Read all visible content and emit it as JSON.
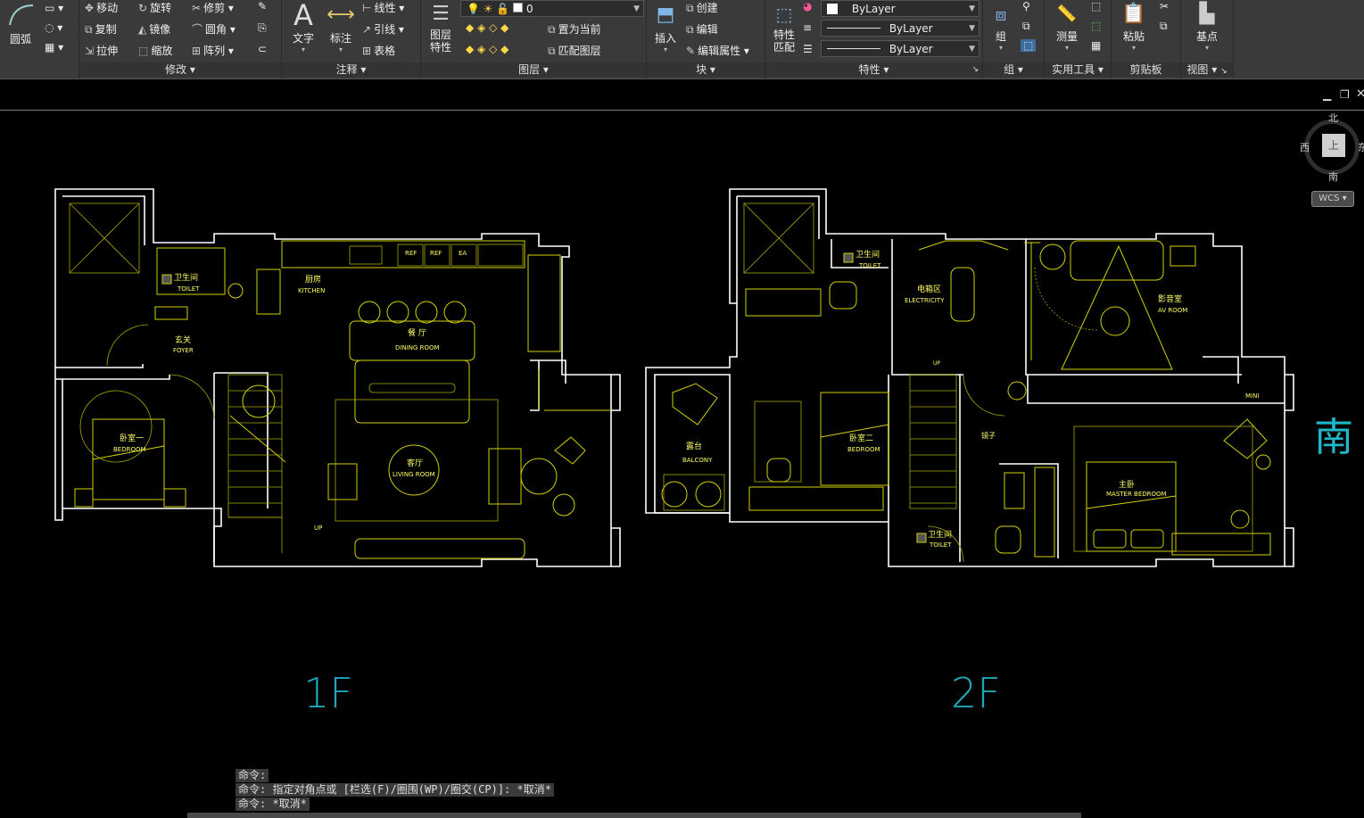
{
  "ribbon": {
    "draw": {
      "arc_label": "圆弧"
    },
    "modify": {
      "title": "修改",
      "move": "移动",
      "rotate": "旋转",
      "trim": "修剪",
      "copy": "复制",
      "mirror": "镜像",
      "fillet": "圆角",
      "stretch": "拉伸",
      "scale": "缩放",
      "array": "阵列"
    },
    "annotation": {
      "title": "注释",
      "text": "文字",
      "dimension": "标注",
      "linear": "线性",
      "leader": "引线",
      "table": "表格"
    },
    "layers": {
      "title": "图层",
      "properties_line1": "图层",
      "properties_line2": "特性",
      "current_layer": "0",
      "set_current": "置为当前",
      "match_layer": "匹配图层"
    },
    "block": {
      "title": "块",
      "insert": "插入",
      "create": "创建",
      "edit": "编辑",
      "edit_attr": "编辑属性"
    },
    "properties": {
      "title": "特性",
      "match_line1": "特性",
      "match_line2": "匹配",
      "color": "ByLayer",
      "linetype": "ByLayer",
      "lineweight": "ByLayer"
    },
    "group": {
      "title": "组",
      "group": "组"
    },
    "utilities": {
      "title": "实用工具",
      "measure": "测量"
    },
    "clipboard": {
      "title": "剪贴板",
      "paste": "粘贴"
    },
    "view": {
      "title": "视图",
      "basepoint": "基点"
    }
  },
  "viewcube": {
    "north": "北",
    "south": "南",
    "west": "西",
    "east": "东",
    "top": "上",
    "wcs": "WCS"
  },
  "side_label": "南",
  "plan": {
    "f1": {
      "label": "1F",
      "rooms": {
        "toilet_cn": "卫生间",
        "toilet_en": "TOILET",
        "kitchen_cn": "厨房",
        "kitchen_en": "KITCHEN",
        "foyer_cn": "玄关",
        "foyer_en": "FOYER",
        "dining_cn": "餐 厅",
        "dining_en": "DINING ROOM",
        "bedroom1_cn": "卧室一",
        "bedroom1_en": "BEDROOM",
        "living_cn": "客厅",
        "living_en": "LIVING ROOM",
        "up": "UP",
        "ref1": "REF",
        "ref2": "REF",
        "ea": "EA"
      }
    },
    "f2": {
      "label": "2F",
      "rooms": {
        "toilet_cn": "卫生间",
        "toilet_en": "TOILET",
        "elec_cn": "电箱区",
        "elec_en": "ELECTRICITY",
        "av_cn": "影音室",
        "av_en": "AV ROOM",
        "balcony_cn": "露台",
        "balcony_en": "BALCONY",
        "bedroom2_cn": "卧室二",
        "bedroom2_en": "BEDROOM",
        "master_cn": "主卧",
        "master_en": "MASTER BEDROOM",
        "toilet2_cn": "卫生间",
        "toilet2_en": "TOILET",
        "mirror": "镜子",
        "mini": "MINI",
        "up": "UP"
      }
    }
  },
  "command_line": {
    "line1": "命令:",
    "line2": "命令: 指定对角点或 [栏选(F)/圈围(WP)/圈交(CP)]: *取消*",
    "line3": "命令: *取消*"
  }
}
